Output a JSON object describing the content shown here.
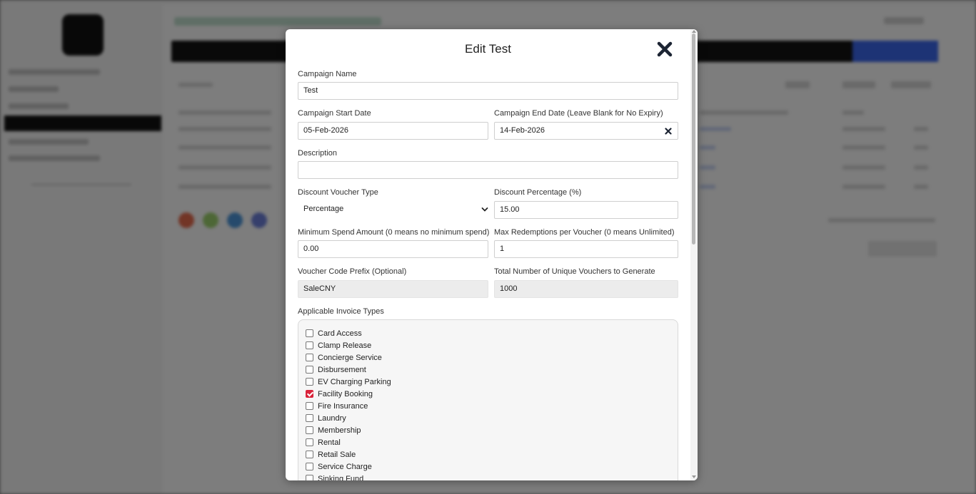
{
  "modal": {
    "title": "Edit Test",
    "fields": {
      "campaign_name": {
        "label": "Campaign Name",
        "value": "Test"
      },
      "start_date": {
        "label": "Campaign Start Date",
        "value": "05-Feb-2026"
      },
      "end_date": {
        "label": "Campaign End Date (Leave Blank for No Expiry)",
        "value": "14-Feb-2026"
      },
      "description": {
        "label": "Description",
        "value": ""
      },
      "voucher_type": {
        "label": "Discount Voucher Type",
        "value": "Percentage"
      },
      "discount_pct": {
        "label": "Discount Percentage (%)",
        "value": "15.00"
      },
      "min_spend": {
        "label": "Minimum Spend Amount (0 means no minimum spend)",
        "value": "0.00"
      },
      "max_redemptions": {
        "label": "Max Redemptions per Voucher (0 means Unlimited)",
        "value": "1"
      },
      "code_prefix": {
        "label": "Voucher Code Prefix (Optional)",
        "value": "SaleCNY"
      },
      "total_vouchers": {
        "label": "Total Number of Unique Vouchers to Generate",
        "value": "1000"
      }
    },
    "invoice_types": {
      "label": "Applicable Invoice Types",
      "items": [
        {
          "label": "Card Access",
          "checked": false
        },
        {
          "label": "Clamp Release",
          "checked": false
        },
        {
          "label": "Concierge Service",
          "checked": false
        },
        {
          "label": "Disbursement",
          "checked": false
        },
        {
          "label": "EV Charging Parking",
          "checked": false
        },
        {
          "label": "Facility Booking",
          "checked": true
        },
        {
          "label": "Fire Insurance",
          "checked": false
        },
        {
          "label": "Laundry",
          "checked": false
        },
        {
          "label": "Membership",
          "checked": false
        },
        {
          "label": "Rental",
          "checked": false
        },
        {
          "label": "Retail Sale",
          "checked": false
        },
        {
          "label": "Service Charge",
          "checked": false
        },
        {
          "label": "Sinking Fund",
          "checked": false
        }
      ]
    }
  },
  "colors": {
    "checkbox_checked": "#d9233a",
    "close_icon": "#1c2433",
    "background_bar": "#121212",
    "background_accent": "#3b66ea"
  }
}
